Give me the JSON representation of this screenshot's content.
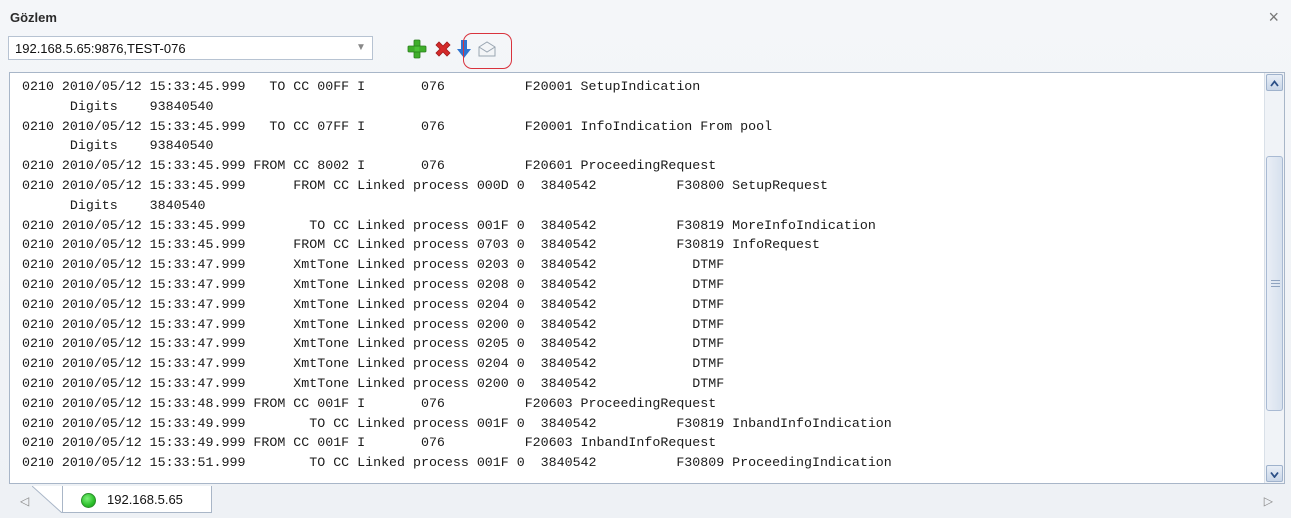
{
  "window": {
    "title": "Gözlem",
    "close_glyph": "×"
  },
  "toolbar": {
    "connection_value": "192.168.5.65:9876,TEST-076",
    "buttons": [
      {
        "name": "add-icon",
        "color": "#3fae2a"
      },
      {
        "name": "delete-icon",
        "color": "#d42a2a"
      },
      {
        "name": "download-icon",
        "color": "#2f74d0"
      },
      {
        "name": "envelope-icon",
        "color": "#9aa6b2"
      }
    ]
  },
  "log": {
    "lines": [
      "0210 2010/05/12 15:33:45.999   TO CC 00FF I       076          F20001 SetupIndication",
      "      Digits    93840540",
      "0210 2010/05/12 15:33:45.999   TO CC 07FF I       076          F20001 InfoIndication From pool",
      "      Digits    93840540",
      "0210 2010/05/12 15:33:45.999 FROM CC 8002 I       076          F20601 ProceedingRequest",
      "0210 2010/05/12 15:33:45.999      FROM CC Linked process 000D 0  3840542          F30800 SetupRequest",
      "      Digits    3840540",
      "0210 2010/05/12 15:33:45.999        TO CC Linked process 001F 0  3840542          F30819 MoreInfoIndication",
      "0210 2010/05/12 15:33:45.999      FROM CC Linked process 0703 0  3840542          F30819 InfoRequest",
      "0210 2010/05/12 15:33:47.999      XmtTone Linked process 0203 0  3840542            DTMF",
      "0210 2010/05/12 15:33:47.999      XmtTone Linked process 0208 0  3840542            DTMF",
      "0210 2010/05/12 15:33:47.999      XmtTone Linked process 0204 0  3840542            DTMF",
      "0210 2010/05/12 15:33:47.999      XmtTone Linked process 0200 0  3840542            DTMF",
      "0210 2010/05/12 15:33:47.999      XmtTone Linked process 0205 0  3840542            DTMF",
      "0210 2010/05/12 15:33:47.999      XmtTone Linked process 0204 0  3840542            DTMF",
      "0210 2010/05/12 15:33:47.999      XmtTone Linked process 0200 0  3840542            DTMF",
      "0210 2010/05/12 15:33:48.999 FROM CC 001F I       076          F20603 ProceedingRequest",
      "0210 2010/05/12 15:33:49.999        TO CC Linked process 001F 0  3840542          F30819 InbandInfoIndication",
      "0210 2010/05/12 15:33:49.999 FROM CC 001F I       076          F20603 InbandInfoRequest",
      "0210 2010/05/12 15:33:51.999        TO CC Linked process 001F 0  3840542          F30809 ProceedingIndication"
    ]
  },
  "tabs": [
    {
      "label": "192.168.5.65",
      "status_color": "#2cbf2b"
    }
  ],
  "nav": {
    "prev_glyph": "◁",
    "next_glyph": "▷"
  }
}
